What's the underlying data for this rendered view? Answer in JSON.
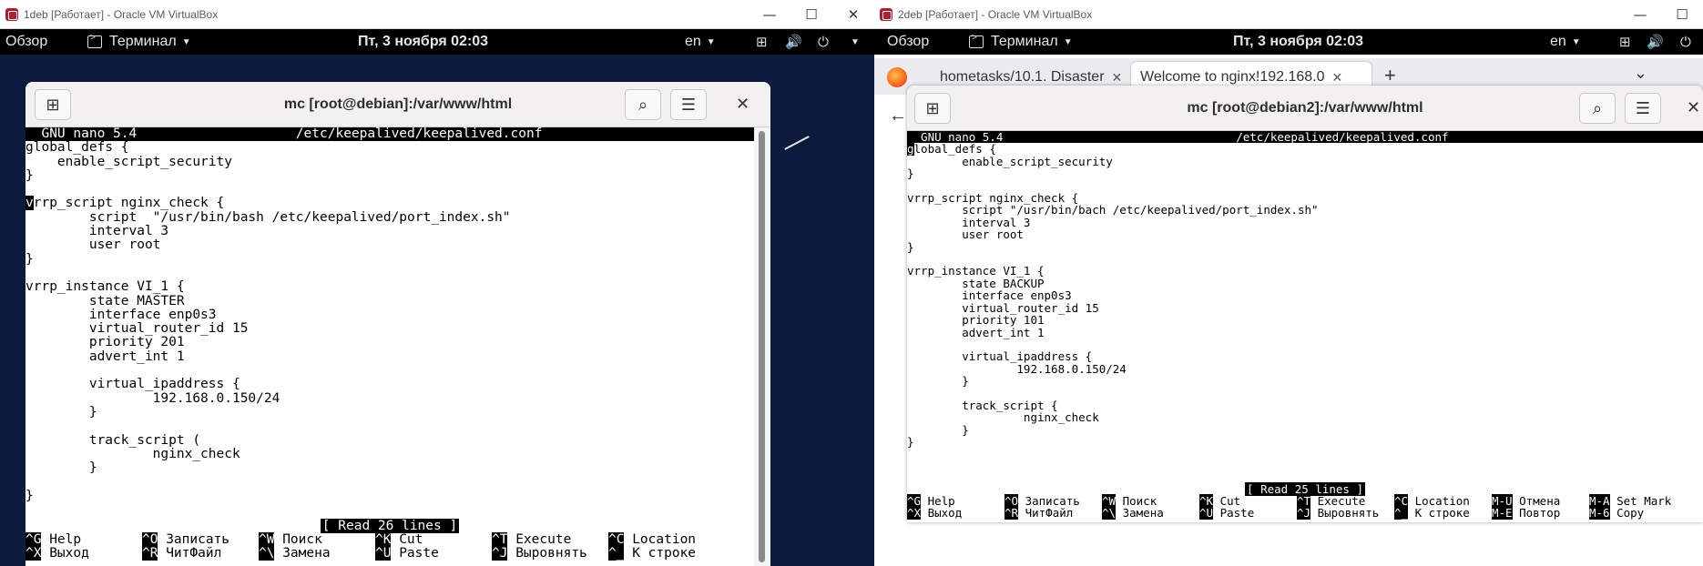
{
  "left": {
    "window_title": "1deb [Работает] - Oracle VM VirtualBox",
    "gnome": {
      "overview": "Обзор",
      "app": "Терминал",
      "clock": "Пт, 3 ноября  02:03",
      "lang": "en"
    },
    "terminal_title": "mc [root@debian]:/var/www/html",
    "nano_header": "  GNU nano 5.4                    /etc/keepalived/keepalived.conf                                  ",
    "file_lines": [
      "global_defs {",
      "    enable_script_security",
      "}",
      "",
      "vrrp_script nginx_check {",
      "        script  \"/usr/bin/bash /etc/keepalived/port_index.sh\"",
      "        interval 3",
      "        user root",
      "}",
      "",
      "vrrp_instance VI_1 {",
      "        state MASTER",
      "        interface enp0s3",
      "        virtual_router_id 15",
      "        priority 201",
      "        advert_int 1",
      "",
      "        virtual_ipaddress {",
      "                192.168.0.150/24",
      "        }",
      "",
      "        track_script (",
      "                nginx_check",
      "        }",
      "",
      "}"
    ],
    "status": "[ Read 26 lines ]",
    "shortcuts_row1": [
      {
        "key": "^G",
        "label": "Help"
      },
      {
        "key": "^O",
        "label": "Записать"
      },
      {
        "key": "^W",
        "label": "Поиск"
      },
      {
        "key": "^K",
        "label": "Cut"
      },
      {
        "key": "^T",
        "label": "Execute"
      },
      {
        "key": "^C",
        "label": "Location"
      }
    ],
    "shortcuts_row2": [
      {
        "key": "^X",
        "label": "Выход"
      },
      {
        "key": "^R",
        "label": "ЧитФайл"
      },
      {
        "key": "^\\",
        "label": "Замена"
      },
      {
        "key": "^U",
        "label": "Paste"
      },
      {
        "key": "^J",
        "label": "Выровнять"
      },
      {
        "key": "^_",
        "label": "К строке"
      }
    ]
  },
  "right": {
    "window_title": "2deb [Работает] - Oracle VM VirtualBox",
    "gnome": {
      "overview": "Обзор",
      "app": "Терминал",
      "clock": "Пт, 3 ноября  02:03",
      "lang": "en"
    },
    "browser_tabs": [
      {
        "label": "hometasks/10.1. Disaster",
        "close": "✕"
      },
      {
        "label": "Welcome to nginx!192.168.0",
        "close": "✕"
      }
    ],
    "terminal_title": "mc [root@debian2]:/var/www/html",
    "nano_header": "  GNU nano 5.4                                  /etc/keepalived/keepalived.conf                                         ",
    "file_lines": [
      "global_defs {",
      "        enable_script_security",
      "}",
      "",
      "vrrp_script nginx_check {",
      "        script \"/usr/bin/bach /etc/keepalived/port_index.sh\"",
      "        interval 3",
      "        user root",
      "}",
      "",
      "vrrp_instance VI_1 {",
      "        state BACKUP",
      "        interface enp0s3",
      "        virtual_router_id 15",
      "        priority 101",
      "        advert_int 1",
      "",
      "        virtual_ipaddress {",
      "                192.168.0.150/24",
      "        }",
      "",
      "        track_script {",
      "                 nginx_check",
      "        }",
      "}"
    ],
    "status": "[ Read 25 lines ]",
    "shortcuts_row1": [
      {
        "key": "^G",
        "label": "Help"
      },
      {
        "key": "^O",
        "label": "Записать"
      },
      {
        "key": "^W",
        "label": "Поиск"
      },
      {
        "key": "^K",
        "label": "Cut"
      },
      {
        "key": "^T",
        "label": "Execute"
      },
      {
        "key": "^C",
        "label": "Location"
      },
      {
        "key": "M-U",
        "label": "Отмена"
      },
      {
        "key": "M-A",
        "label": "Set Mark"
      }
    ],
    "shortcuts_row2": [
      {
        "key": "^X",
        "label": "Выход"
      },
      {
        "key": "^R",
        "label": "ЧитФайл"
      },
      {
        "key": "^\\",
        "label": "Замена"
      },
      {
        "key": "^U",
        "label": "Paste"
      },
      {
        "key": "^J",
        "label": "Выровнять"
      },
      {
        "key": "^_",
        "label": "К строке"
      },
      {
        "key": "M-E",
        "label": "Повтор"
      },
      {
        "key": "M-6",
        "label": "Copy"
      }
    ]
  },
  "icons": {
    "minimize": "—",
    "maximize": "☐",
    "close": "✕",
    "search": "⌕",
    "menu": "☰",
    "new_tab": "⊞",
    "add_tab": "+",
    "tabs_list": "⌄",
    "back": "←",
    "network": "⊞",
    "volume": "🔊",
    "power": "⏻",
    "caret": "▼"
  },
  "colors": {
    "desktop_left": "#0c1a3e",
    "vbox_red": "#b01e2a"
  }
}
